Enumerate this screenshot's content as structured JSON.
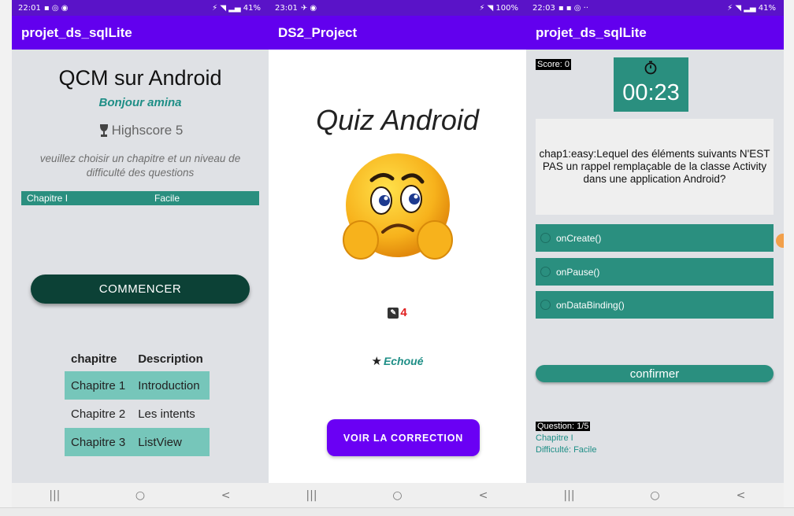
{
  "screen1": {
    "status": {
      "time": "22:01",
      "left_icons": "▪ ◎ ◉",
      "right": "⚡ ◥ ▂▄ 41%"
    },
    "app_title": "projet_ds_sqlLite",
    "title": "QCM sur Android",
    "greeting": "Bonjour amina",
    "highscore": "Highscore 5",
    "instructions": "veuillez choisir un chapitre et un niveau de difficulté des questions",
    "selector": {
      "chapter": "Chapitre I",
      "level": "Facile"
    },
    "start_button": "COMMENCER",
    "table": {
      "headers": [
        "chapitre",
        "Description"
      ],
      "rows": [
        [
          "Chapitre 1",
          "Introduction"
        ],
        [
          "Chapitre 2",
          "Les intents"
        ],
        [
          "Chapitre 3",
          "ListView"
        ]
      ]
    }
  },
  "screen2": {
    "status": {
      "time": "23:01",
      "left_icons": "✈ ◉",
      "right": "⚡ ◥ 100%"
    },
    "app_title": "DS2_Project",
    "quiz_title": "Quiz Android",
    "score": "4",
    "result": "Echoué",
    "correction_button": "VOIR LA CORRECTION"
  },
  "screen3": {
    "status": {
      "time": "22:03",
      "left_icons": "▪ ▪ ◎ ··",
      "right": "⚡ ◥ ▂▄ 41%"
    },
    "app_title": "projet_ds_sqlLite",
    "score_label": "Score: 0",
    "timer": "00:23",
    "question": "chap1:easy:Lequel des éléments suivants N'EST PAS un rappel remplaçable de la classe Activity dans une application Android?",
    "options": [
      "onCreate()",
      "onPause()",
      "onDataBinding()"
    ],
    "confirm_button": "confirmer",
    "question_number": "Question: 1/5",
    "chapter": "Chapitre I",
    "difficulty": "Difficulté: Facile"
  },
  "nav": {
    "recent": "|||",
    "home": "○",
    "back": "<"
  },
  "colors": {
    "appbar": "#6200ee",
    "teal": "#2a8f7f",
    "dark_green": "#0c4136",
    "purple_button": "#6a00f4"
  }
}
